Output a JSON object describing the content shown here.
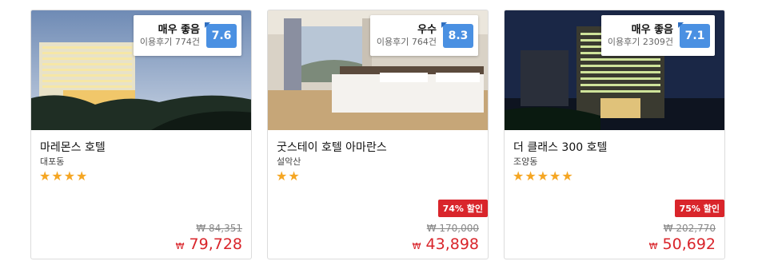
{
  "hotels": [
    {
      "name": "마레몬스 호텔",
      "area": "대포동",
      "stars": "★★★★",
      "review_label": "매우 좋음",
      "review_count": "이용후기 774건",
      "score": "7.6",
      "discount": "",
      "original_price": "₩ 84,351",
      "currency": "₩",
      "price": "79,728"
    },
    {
      "name": "굿스테이 호텔 아마란스",
      "area": "설악산",
      "stars": "★★",
      "review_label": "우수",
      "review_count": "이용후기 764건",
      "score": "8.3",
      "discount": "74% 할인",
      "original_price": "₩ 170,000",
      "currency": "₩",
      "price": "43,898"
    },
    {
      "name": "더 클래스 300 호텔",
      "area": "조양동",
      "stars": "★★★★★",
      "review_label": "매우 좋음",
      "review_count": "이용후기 2309건",
      "score": "7.1",
      "discount": "75% 할인",
      "original_price": "₩ 202,770",
      "currency": "₩",
      "price": "50,692"
    }
  ],
  "colors": {
    "score_badge": "#4a90e2",
    "price": "#d9252b",
    "discount_badge": "#d9252b",
    "stars": "#f5a623"
  }
}
